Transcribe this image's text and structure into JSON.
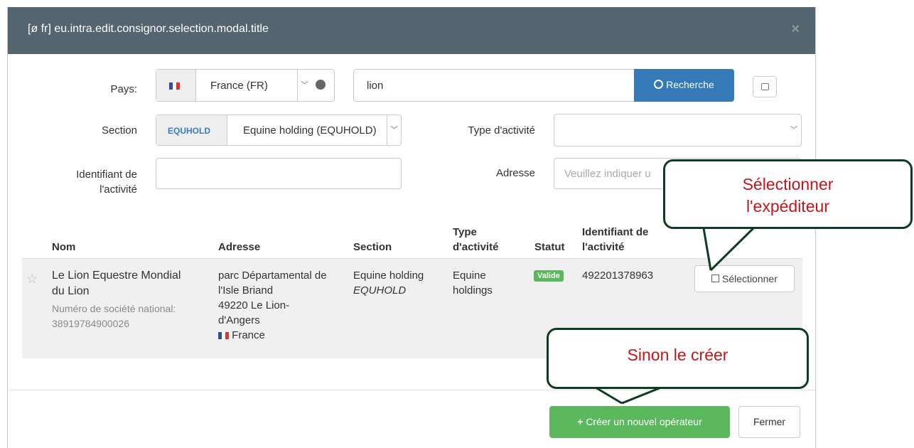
{
  "modal": {
    "title": "[ø fr] eu.intra.edit.consignor.selection.modal.title",
    "close_icon": "×"
  },
  "form": {
    "pays_label": "Pays:",
    "pays_value": "France (FR)",
    "search_value": "lion",
    "search_button": "Recherche",
    "section_label": "Section",
    "section_code": "EQUHOLD",
    "section_value": "Equine holding (EQUHOLD)",
    "type_label": "Type d'activité",
    "type_value": "",
    "ident_label_1": "Identifiant de",
    "ident_label_2": "l'activité",
    "ident_value": "",
    "adresse_label": "Adresse",
    "adresse_placeholder": "Veuillez indiquer u"
  },
  "table": {
    "headers": {
      "nom": "Nom",
      "adresse": "Adresse",
      "section": "Section",
      "type_1": "Type",
      "type_2": "d'activité",
      "statut": "Statut",
      "ident_1": "Identifiant de",
      "ident_2": "l'activité"
    },
    "row": {
      "nom_1": "Le Lion Equestre Mondial",
      "nom_2": "du Lion",
      "national_1": "Numéro de société national:",
      "national_2": "38919784900026",
      "adresse_1": "parc Départamental de",
      "adresse_2": "l'Isle Briand",
      "adresse_3": "49220 Le Lion-",
      "adresse_4": "d'Angers",
      "adresse_country": "France",
      "section_1": "Equine holding",
      "section_2": "EQUHOLD",
      "type_1": "Equine",
      "type_2": "holdings",
      "statut": "Valide",
      "identifiant": "492201378963",
      "select_button": "Sélectionner"
    }
  },
  "footer": {
    "create_button": "Créer un nouvel opérateur",
    "close_button": "Fermer"
  },
  "callouts": {
    "select_1": "Sélectionner",
    "select_2": "l'expéditeur",
    "create": "Sinon le créer"
  },
  "colors": {
    "header": "#54656f",
    "primary": "#337ab7",
    "success": "#5cb85c",
    "callout_border": "#0e3b24",
    "callout_text": "#c0161c"
  },
  "icons": [
    "star-icon",
    "globe-icon",
    "search-icon",
    "collapse-icon",
    "edit-icon",
    "plus-icon",
    "flag-france-icon",
    "close-icon"
  ]
}
